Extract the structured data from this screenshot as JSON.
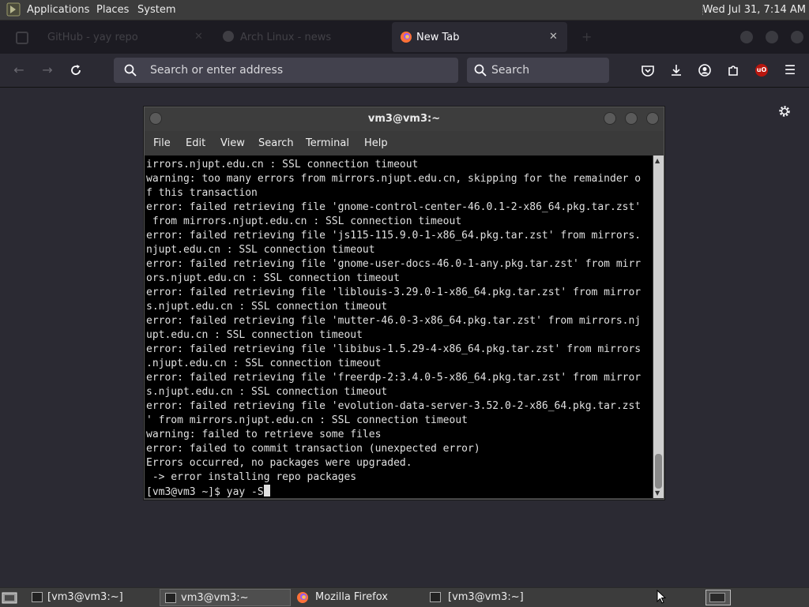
{
  "top_panel": {
    "menus": [
      "Applications",
      "Places",
      "System"
    ],
    "clock": "Wed Jul 31,  7:14 AM"
  },
  "browser": {
    "tabs": [
      {
        "label": "GitHub - yay repo",
        "state": "inactive"
      },
      {
        "label": "Arch Linux - news",
        "state": "inactive"
      },
      {
        "label": "New Tab",
        "state": "active"
      }
    ],
    "urlbar_placeholder": "Search or enter address",
    "searchbar_placeholder": "Search",
    "toolbar_icons": [
      "pocket-icon",
      "download-icon",
      "account-icon",
      "extensions-icon",
      "ublock-icon",
      "menu-icon"
    ],
    "ublock_badge": "uO"
  },
  "terminal": {
    "title": "vm3@vm3:~",
    "menu": [
      "File",
      "Edit",
      "View",
      "Search",
      "Terminal",
      "Help"
    ],
    "lines": [
      "irrors.njupt.edu.cn : SSL connection timeout",
      "warning: too many errors from mirrors.njupt.edu.cn, skipping for the remainder o",
      "f this transaction",
      "error: failed retrieving file 'gnome-control-center-46.0.1-2-x86_64.pkg.tar.zst'",
      " from mirrors.njupt.edu.cn : SSL connection timeout",
      "error: failed retrieving file 'js115-115.9.0-1-x86_64.pkg.tar.zst' from mirrors.",
      "njupt.edu.cn : SSL connection timeout",
      "error: failed retrieving file 'gnome-user-docs-46.0-1-any.pkg.tar.zst' from mirr",
      "ors.njupt.edu.cn : SSL connection timeout",
      "error: failed retrieving file 'liblouis-3.29.0-1-x86_64.pkg.tar.zst' from mirror",
      "s.njupt.edu.cn : SSL connection timeout",
      "error: failed retrieving file 'mutter-46.0-3-x86_64.pkg.tar.zst' from mirrors.nj",
      "upt.edu.cn : SSL connection timeout",
      "error: failed retrieving file 'libibus-1.5.29-4-x86_64.pkg.tar.zst' from mirrors",
      ".njupt.edu.cn : SSL connection timeout",
      "error: failed retrieving file 'freerdp-2:3.4.0-5-x86_64.pkg.tar.zst' from mirror",
      "s.njupt.edu.cn : SSL connection timeout",
      "error: failed retrieving file 'evolution-data-server-3.52.0-2-x86_64.pkg.tar.zst",
      "' from mirrors.njupt.edu.cn : SSL connection timeout",
      "warning: failed to retrieve some files",
      "error: failed to commit transaction (unexpected error)",
      "Errors occurred, no packages were upgraded.",
      " -> error installing repo packages"
    ],
    "prompt": "[vm3@vm3 ~]$ yay -S"
  },
  "taskbar": {
    "tasks": [
      {
        "label": "[vm3@vm3:~]",
        "active": false
      },
      {
        "label": "vm3@vm3:~",
        "active": true
      },
      {
        "label": "Mozilla Firefox",
        "active": false
      },
      {
        "label": "[vm3@vm3:~]",
        "active": false
      }
    ]
  }
}
